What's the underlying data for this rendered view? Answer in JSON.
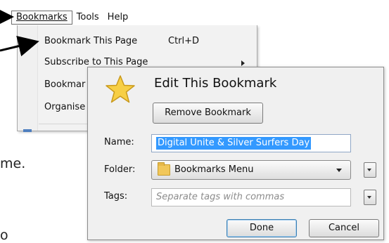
{
  "menubar": {
    "items": [
      {
        "label": "Bookmarks",
        "active": true
      },
      {
        "label": "Tools",
        "active": false
      },
      {
        "label": "Help",
        "active": false
      }
    ]
  },
  "bookmarks_menu": {
    "items": [
      {
        "label": "Bookmark This Page",
        "shortcut": "Ctrl+D"
      },
      {
        "label": "Subscribe to This Page",
        "submenu": true
      },
      {
        "label": "Bookmar"
      },
      {
        "label": "Organise"
      }
    ]
  },
  "background_text": {
    "line1": "me.",
    "line2": "o"
  },
  "dialog": {
    "title": "Edit This Bookmark",
    "remove_button": "Remove Bookmark",
    "name_label": "Name:",
    "name_value": "Digital Unite & Silver Surfers Day",
    "folder_label": "Folder:",
    "folder_value": "Bookmarks Menu",
    "tags_label": "Tags:",
    "tags_placeholder": "Separate tags with commas",
    "done_button": "Done",
    "cancel_button": "Cancel"
  },
  "colors": {
    "selection": "#3399ff",
    "star_fill": "#f7cf45",
    "folder": "#f1c75a"
  }
}
